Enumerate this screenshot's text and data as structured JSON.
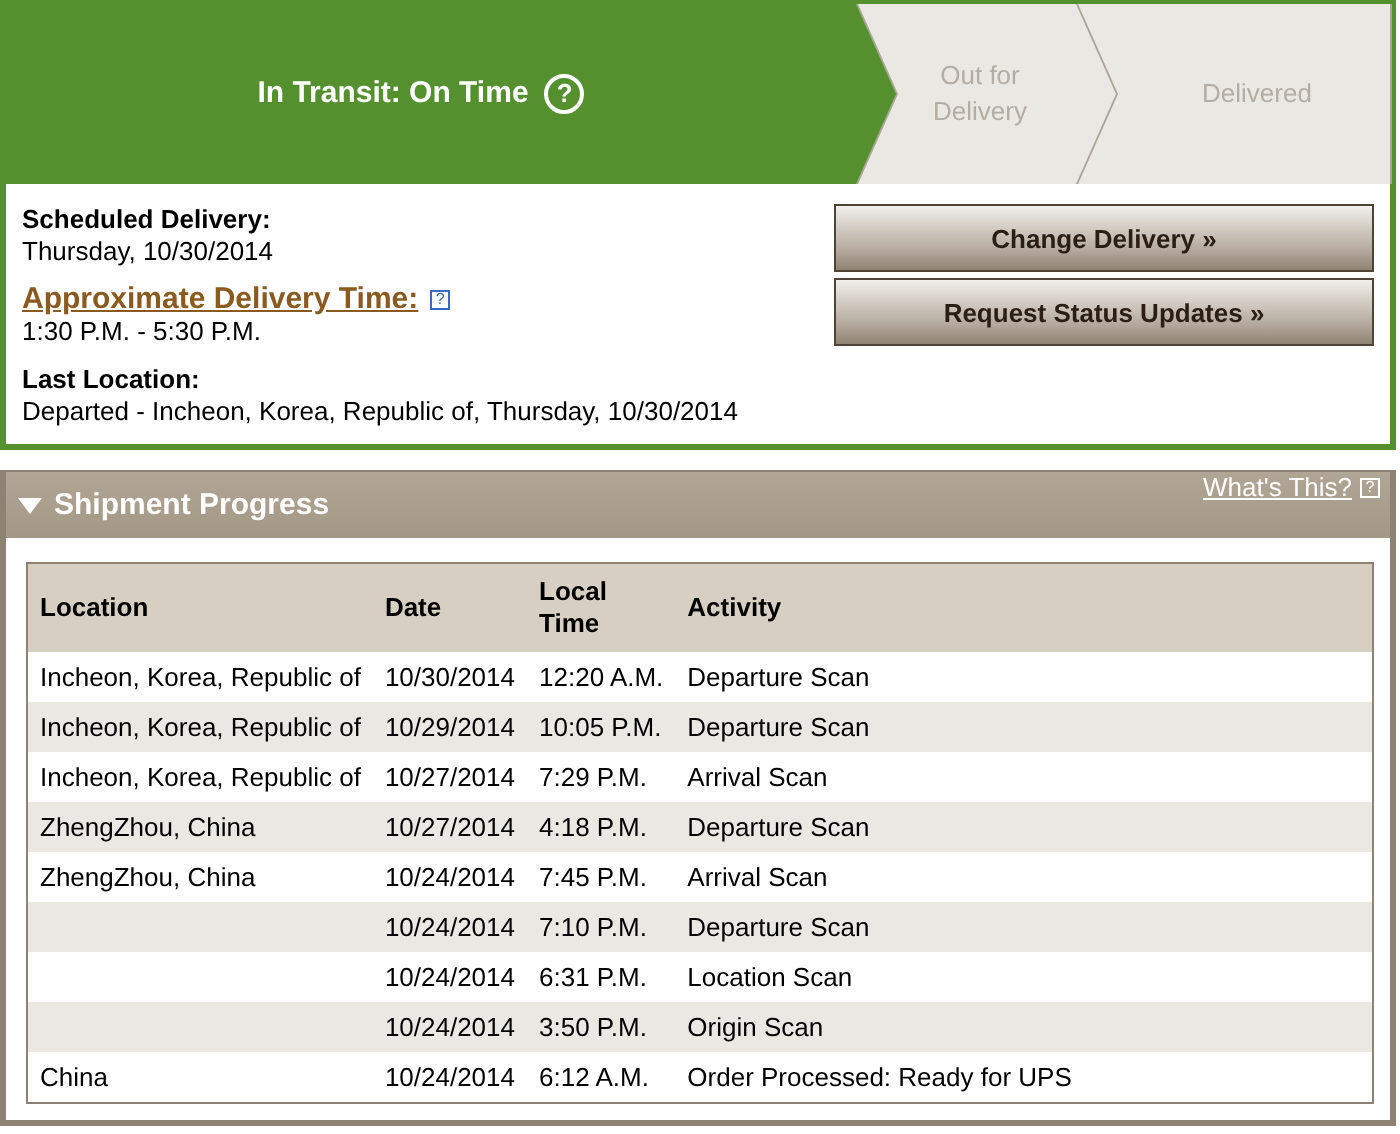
{
  "progress_steps": [
    {
      "label": "In Transit: On Time",
      "current": true,
      "help": "?"
    },
    {
      "label": "Out for Delivery",
      "current": false
    },
    {
      "label": "Delivered",
      "current": false
    }
  ],
  "details": [
    {
      "label": "Scheduled Delivery:",
      "value": "Thursday, 10/30/2014",
      "kind": "plain"
    },
    {
      "label": "Approximate Delivery Time:",
      "value": "1:30 P.M. - 5:30 P.M.",
      "kind": "link",
      "help": "?"
    },
    {
      "label": "Last Location:",
      "value": "Departed - Incheon, Korea, Republic of, Thursday, 10/30/2014",
      "kind": "plain"
    }
  ],
  "buttons": [
    "Change Delivery »",
    "Request Status Updates »"
  ],
  "shipment_progress": {
    "title": "Shipment Progress",
    "expanded": true,
    "help_link": "What's This?",
    "help": "?",
    "columns": [
      "Location",
      "Date",
      "Local Time",
      "Activity"
    ],
    "rows": [
      [
        "Incheon, Korea, Republic of",
        "10/30/2014",
        "12:20 A.M.",
        "Departure Scan"
      ],
      [
        "Incheon, Korea, Republic of",
        "10/29/2014",
        "10:05 P.M.",
        "Departure Scan"
      ],
      [
        "Incheon, Korea, Republic of",
        "10/27/2014",
        "7:29 P.M.",
        "Arrival Scan"
      ],
      [
        "ZhengZhou, China",
        "10/27/2014",
        "4:18 P.M.",
        "Departure Scan"
      ],
      [
        "ZhengZhou, China",
        "10/24/2014",
        "7:45 P.M.",
        "Arrival Scan"
      ],
      [
        "",
        "10/24/2014",
        "7:10 P.M.",
        "Departure Scan"
      ],
      [
        "",
        "10/24/2014",
        "6:31 P.M.",
        "Location Scan"
      ],
      [
        "",
        "10/24/2014",
        "3:50 P.M.",
        "Origin Scan"
      ],
      [
        "China",
        "10/24/2014",
        "6:12 A.M.",
        "Order Processed: Ready for UPS"
      ]
    ]
  }
}
